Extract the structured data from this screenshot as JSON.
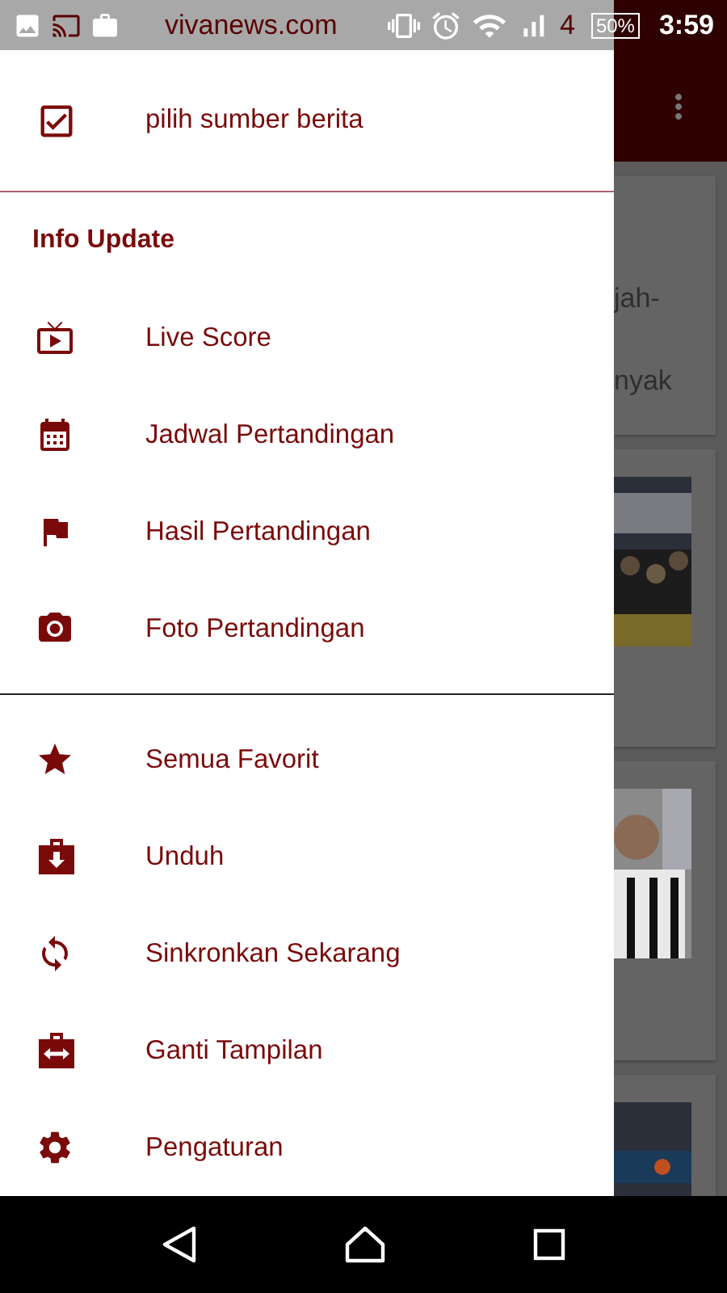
{
  "status_bar": {
    "app_title": "vivanews.com",
    "network": "4",
    "battery": "50%",
    "time": "3:59"
  },
  "drawer": {
    "top_item": {
      "label": "pilih sumber berita"
    },
    "section_title": "Info Update",
    "info_items": [
      {
        "label": "Live Score"
      },
      {
        "label": "Jadwal Pertandingan"
      },
      {
        "label": "Hasil Pertandingan"
      },
      {
        "label": "Foto Pertandingan"
      }
    ],
    "more_items": [
      {
        "label": "Semua Favorit"
      },
      {
        "label": "Unduh"
      },
      {
        "label": "Sinkronkan Sekarang"
      },
      {
        "label": "Ganti Tampilan"
      },
      {
        "label": "Pengaturan"
      }
    ]
  },
  "background_feed": [
    {
      "kind": "text",
      "lines": [
        "jah-",
        "nyak"
      ]
    },
    {
      "kind": "picture"
    },
    {
      "kind": "picture"
    },
    {
      "kind": "picture"
    }
  ]
}
